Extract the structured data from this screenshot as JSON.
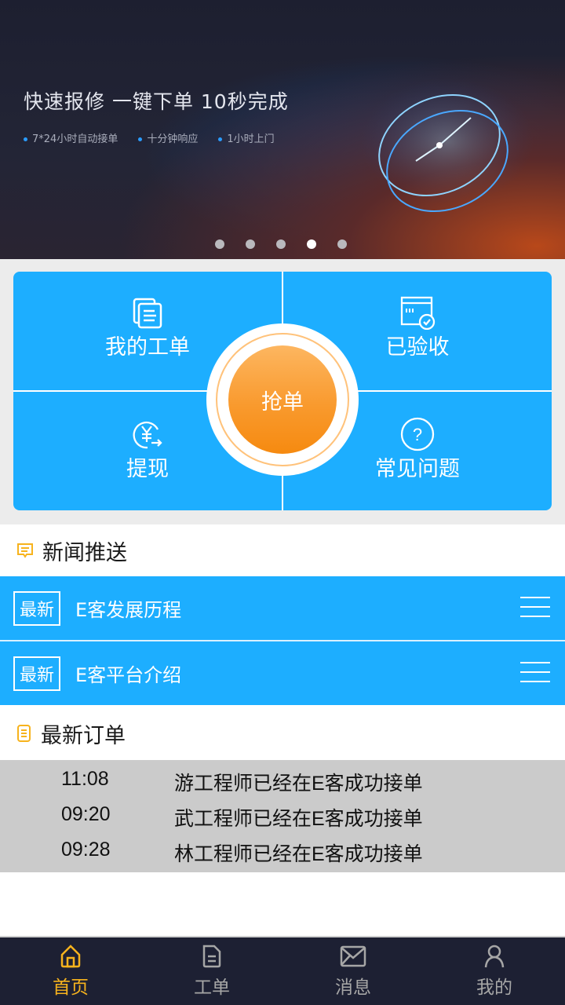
{
  "banner": {
    "title": "快速报修 一键下单 10秒完成",
    "features": [
      "7*24小时自动接单",
      "十分钟响应",
      "1小时上门"
    ],
    "carousel": {
      "total": 5,
      "active_index": 3
    }
  },
  "grid": {
    "items": [
      {
        "label": "我的工单",
        "icon": "documents-icon"
      },
      {
        "label": "已验收",
        "icon": "accepted-check-icon"
      },
      {
        "label": "提现",
        "icon": "yuan-withdraw-icon"
      },
      {
        "label": "常见问题",
        "icon": "question-icon"
      }
    ],
    "center_button": "抢单"
  },
  "news": {
    "title": "新闻推送",
    "items": [
      {
        "badge": "最新",
        "title": "E客发展历程"
      },
      {
        "badge": "最新",
        "title": "E客平台介绍"
      }
    ]
  },
  "orders": {
    "title": "最新订单",
    "rows": [
      {
        "time": "11:08",
        "message": "游工程师已经在E客成功接单"
      },
      {
        "time": "09:20",
        "message": "武工程师已经在E客成功接单"
      },
      {
        "time": "09:28",
        "message": "林工程师已经在E客成功接单"
      }
    ]
  },
  "tabbar": {
    "items": [
      {
        "label": "首页",
        "icon": "home-icon",
        "active": true
      },
      {
        "label": "工单",
        "icon": "document-icon",
        "active": false
      },
      {
        "label": "消息",
        "icon": "mail-icon",
        "active": false
      },
      {
        "label": "我的",
        "icon": "user-icon",
        "active": false
      }
    ]
  },
  "colors": {
    "primary": "#1daeff",
    "accent": "#f7b31d",
    "orange": "#f68a10",
    "tabbar_bg": "#1d2033"
  }
}
